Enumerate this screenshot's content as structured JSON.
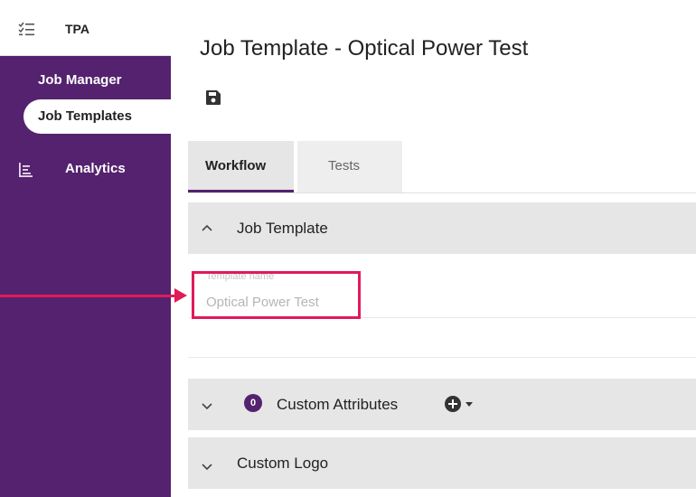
{
  "app": {
    "title": "TPA",
    "tpa_icon": "checklist-icon"
  },
  "sidebar": {
    "section_label": "Job Manager",
    "items": [
      {
        "label": "Job Templates",
        "active": true
      },
      {
        "label": "Analytics",
        "icon": "analytics-icon"
      }
    ]
  },
  "page": {
    "title": "Job Template - Optical Power Test",
    "save_icon": "save-icon"
  },
  "tabs": [
    {
      "label": "Workflow",
      "active": true
    },
    {
      "label": "Tests",
      "active": false
    }
  ],
  "panels": {
    "job_template": {
      "title": "Job Template",
      "expanded": true,
      "field": {
        "label": "Template name",
        "value": "Optical Power Test"
      }
    },
    "custom_attributes": {
      "title": "Custom Attributes",
      "count": "0",
      "expanded": false
    },
    "custom_logo": {
      "title": "Custom Logo",
      "expanded": false
    }
  },
  "colors": {
    "sidebar": "#54226e",
    "accent": "#54226e",
    "annotation": "#e11a5a",
    "panel_header": "#e6e6e6"
  }
}
